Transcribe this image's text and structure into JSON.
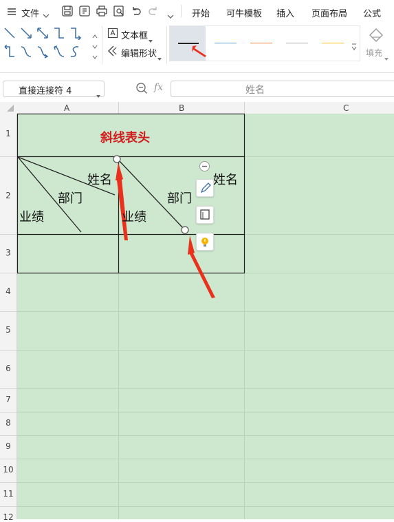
{
  "menubar": {
    "file_label": "文件",
    "tabs": [
      "开始",
      "可牛模板",
      "插入",
      "页面布局",
      "公式"
    ]
  },
  "ribbon": {
    "textbox_label": "文本框",
    "edit_shape_label": "编辑形状",
    "fill_label": "填充",
    "line_colors": [
      "#222222",
      "#5b9bd5",
      "#ed7d31",
      "#a5a5a5",
      "#ffc000"
    ]
  },
  "formula_bar": {
    "name_box": "直接连接符 4",
    "fx_label": "fx",
    "formula_value": "姓名"
  },
  "sheet": {
    "columns": [
      "A",
      "B",
      "C"
    ],
    "rows": [
      "1",
      "2",
      "3",
      "4",
      "5",
      "6",
      "7",
      "8",
      "9",
      "10",
      "11",
      "12"
    ],
    "title": "斜线表头",
    "cell_labels": {
      "a_name": "姓名",
      "a_dept": "部门",
      "a_perf": "业绩",
      "b_name": "姓名",
      "b_dept": "部门",
      "b_perf": "业绩"
    }
  },
  "colors": {
    "accent": "#d01e1e",
    "sheet_bg": "#cde8ce",
    "arrow": "#e8321e"
  }
}
